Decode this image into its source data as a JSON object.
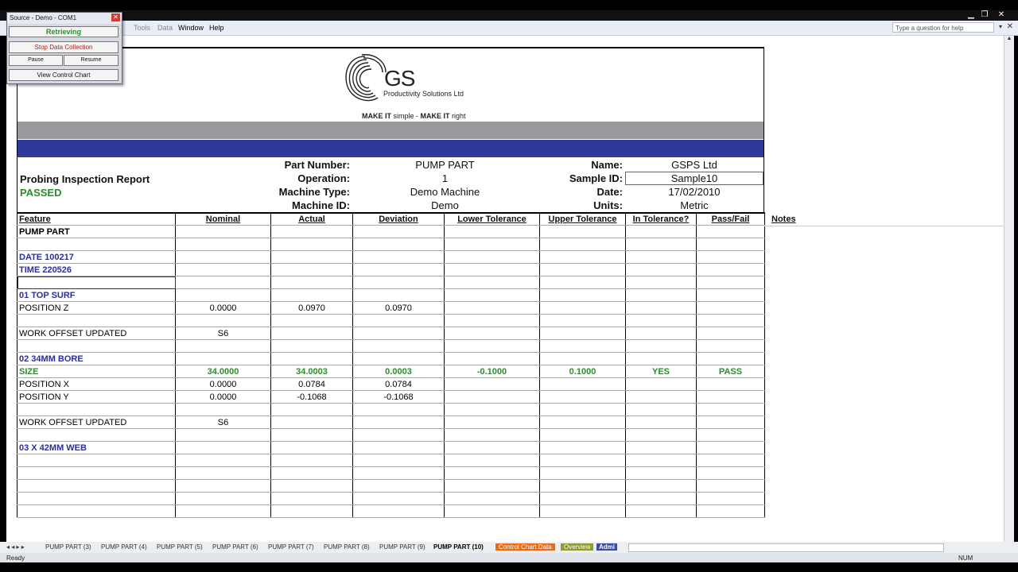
{
  "window": {
    "minimize": "▁",
    "restore": "❐",
    "close": "✕"
  },
  "menu": {
    "items": [
      {
        "label": "Tools",
        "dim": true
      },
      {
        "label": "Data",
        "dim": true
      },
      {
        "label": "Window",
        "dim": false
      },
      {
        "label": "Help",
        "dim": false
      }
    ],
    "help_placeholder": "Type a question for help"
  },
  "popup": {
    "title": "Source - Demo - COM1",
    "status": "Retrieving",
    "stop": "Stop Data Collection",
    "pause": "Pause",
    "resume": "Resume",
    "control_chart": "View Control Chart"
  },
  "logo": {
    "letters": "GS",
    "company": "Productivity Solutions Ltd",
    "tagline_1": "MAKE IT",
    "tagline_2": " simple - ",
    "tagline_3": "MAKE IT",
    "tagline_4": " right"
  },
  "header": {
    "report_title": "Probing Inspection Report",
    "result": "PASSED",
    "part_number_label": "Part Number:",
    "part_number": "PUMP PART",
    "operation_label": "Operation:",
    "operation": "1",
    "machine_type_label": "Machine Type:",
    "machine_type": "Demo Machine",
    "machine_id_label": "Machine ID:",
    "machine_id": "Demo",
    "name_label": "Name:",
    "name": "GSPS Ltd",
    "sample_id_label": "Sample ID:",
    "sample_id": "Sample10",
    "date_label": "Date:",
    "date": "17/02/2010",
    "units_label": "Units:",
    "units": "Metric"
  },
  "table": {
    "columns": [
      "Feature",
      "Nominal",
      "Actual",
      "Deviation",
      "Lower Tolerance",
      "Upper Tolerance",
      "In Tolerance?",
      "Pass/Fail"
    ],
    "notes_header": "Notes",
    "rows": [
      {
        "style": "bold",
        "cells": [
          "PUMP PART",
          "",
          "",
          "",
          "",
          "",
          "",
          ""
        ]
      },
      {
        "style": "",
        "cells": [
          "",
          "",
          "",
          "",
          "",
          "",
          "",
          ""
        ]
      },
      {
        "style": "blue",
        "cells": [
          "DATE 100217",
          "",
          "",
          "",
          "",
          "",
          "",
          ""
        ]
      },
      {
        "style": "blue",
        "cells": [
          "TIME 220526",
          "",
          "",
          "",
          "",
          "",
          "",
          ""
        ]
      },
      {
        "style": "selected",
        "cells": [
          "",
          "",
          "",
          "",
          "",
          "",
          "",
          ""
        ]
      },
      {
        "style": "blue",
        "cells": [
          "01 TOP SURF",
          "",
          "",
          "",
          "",
          "",
          "",
          ""
        ]
      },
      {
        "style": "",
        "cells": [
          "POSITION Z",
          "0.0000",
          "0.0970",
          "0.0970",
          "",
          "",
          "",
          ""
        ]
      },
      {
        "style": "",
        "cells": [
          "",
          "",
          "",
          "",
          "",
          "",
          "",
          ""
        ]
      },
      {
        "style": "",
        "cells": [
          "WORK OFFSET UPDATED",
          "S6",
          "",
          "",
          "",
          "",
          "",
          ""
        ]
      },
      {
        "style": "",
        "cells": [
          "",
          "",
          "",
          "",
          "",
          "",
          "",
          ""
        ]
      },
      {
        "style": "blue",
        "cells": [
          "02 34MM BORE",
          "",
          "",
          "",
          "",
          "",
          "",
          ""
        ]
      },
      {
        "style": "green",
        "cells": [
          "SIZE",
          "34.0000",
          "34.0003",
          "0.0003",
          "-0.1000",
          "0.1000",
          "YES",
          "PASS"
        ]
      },
      {
        "style": "",
        "cells": [
          "POSITION X",
          "0.0000",
          "0.0784",
          "0.0784",
          "",
          "",
          "",
          ""
        ]
      },
      {
        "style": "",
        "cells": [
          "POSITION Y",
          "0.0000",
          "-0.1068",
          "-0.1068",
          "",
          "",
          "",
          ""
        ]
      },
      {
        "style": "",
        "cells": [
          "",
          "",
          "",
          "",
          "",
          "",
          "",
          ""
        ]
      },
      {
        "style": "",
        "cells": [
          "WORK OFFSET UPDATED",
          "S6",
          "",
          "",
          "",
          "",
          "",
          ""
        ]
      },
      {
        "style": "",
        "cells": [
          "",
          "",
          "",
          "",
          "",
          "",
          "",
          ""
        ]
      },
      {
        "style": "blue",
        "cells": [
          "03 X 42MM WEB",
          "",
          "",
          "",
          "",
          "",
          "",
          ""
        ]
      },
      {
        "style": "",
        "cells": [
          "",
          "",
          "",
          "",
          "",
          "",
          "",
          ""
        ]
      },
      {
        "style": "",
        "cells": [
          "",
          "",
          "",
          "",
          "",
          "",
          "",
          ""
        ]
      },
      {
        "style": "",
        "cells": [
          "",
          "",
          "",
          "",
          "",
          "",
          "",
          ""
        ]
      },
      {
        "style": "",
        "cells": [
          "",
          "",
          "",
          "",
          "",
          "",
          "",
          ""
        ]
      },
      {
        "style": "",
        "cells": [
          "",
          "",
          "",
          "",
          "",
          "",
          "",
          ""
        ]
      }
    ]
  },
  "tabs": {
    "nav": "◂ ◂ ▸ ▸",
    "items": [
      {
        "label": "PUMP PART (3)",
        "kind": ""
      },
      {
        "label": "PUMP PART (4)",
        "kind": ""
      },
      {
        "label": "PUMP PART (5)",
        "kind": ""
      },
      {
        "label": "PUMP PART (6)",
        "kind": ""
      },
      {
        "label": "PUMP PART (7)",
        "kind": ""
      },
      {
        "label": "PUMP PART (8)",
        "kind": ""
      },
      {
        "label": "PUMP PART (9)",
        "kind": ""
      },
      {
        "label": "PUMP PART (10)",
        "kind": "active"
      },
      {
        "label": "Control Chart Data",
        "kind": "orange"
      },
      {
        "label": "Overview",
        "kind": "olive"
      },
      {
        "label": "Admi",
        "kind": "blue"
      }
    ]
  },
  "status": {
    "left": "Ready",
    "num": "NUM"
  },
  "colors": {
    "accent_blue": "#2f3a98",
    "pass_green": "#2e8b2e",
    "band_grey": "#999a9e",
    "tab_orange": "#e86c1a",
    "tab_olive": "#8e9b2d"
  }
}
